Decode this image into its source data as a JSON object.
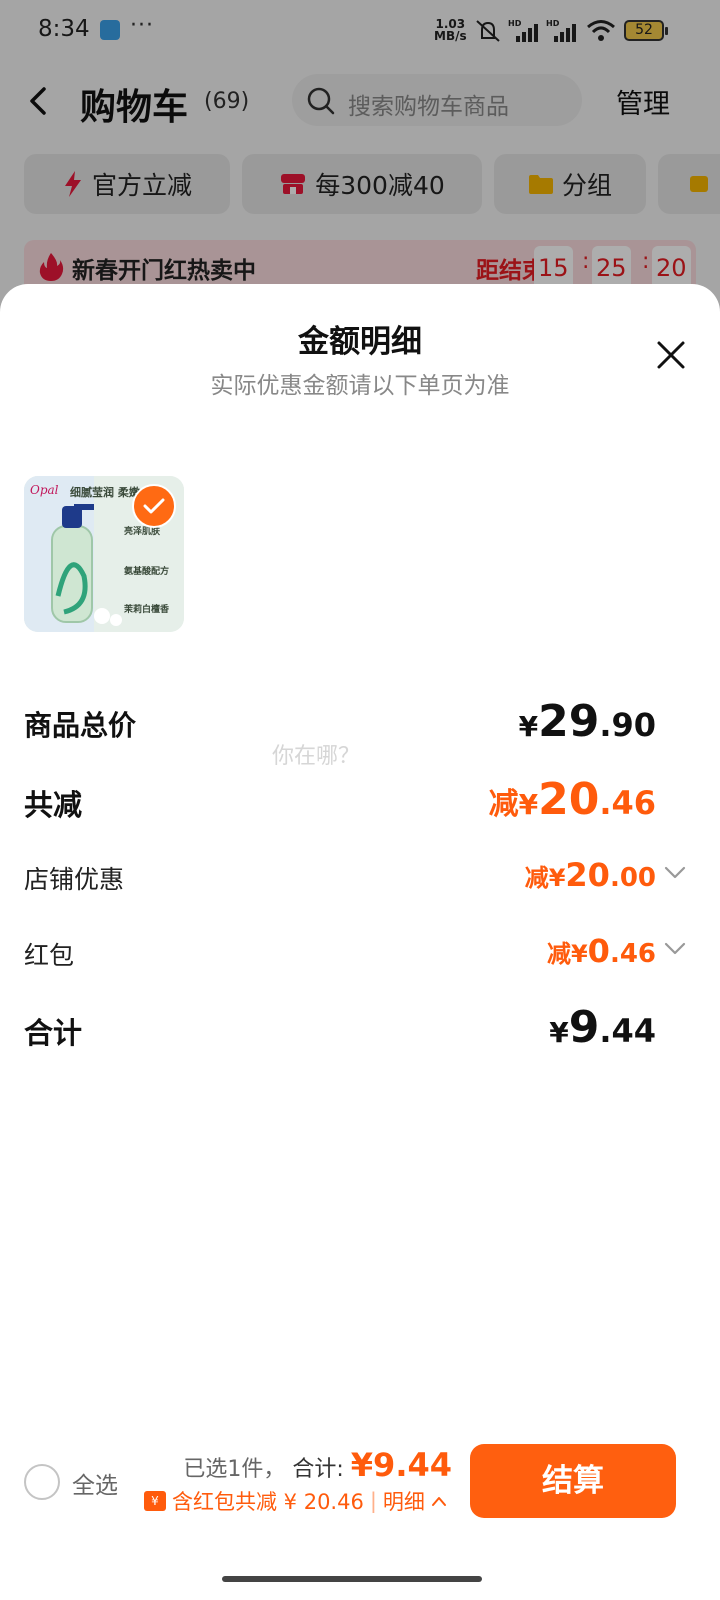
{
  "status_bar": {
    "time": "8:34",
    "more": "···",
    "net_speed_value": "1.03",
    "net_speed_unit": "MB/s",
    "battery": "52"
  },
  "nav": {
    "title": "购物车",
    "count": "(69)",
    "search_placeholder": "搜索购物车商品",
    "manage": "管理"
  },
  "chips": [
    {
      "label": "官方立减",
      "icon": "lightning-icon"
    },
    {
      "label": "每300减40",
      "icon": "shop-icon"
    },
    {
      "label": "分组",
      "icon": "folder-icon"
    }
  ],
  "banner": {
    "text": "新春开门红热卖中",
    "countdown_label": "距结束",
    "hours": "15",
    "minutes": "25",
    "seconds": "20"
  },
  "sheet": {
    "title": "金额明细",
    "subtitle": "实际优惠金额请以下单页为准",
    "product": {
      "thumb_texts": [
        "细腻莹润 柔嫩",
        "亮泽肌肤",
        "氨基酸配方",
        "茉莉白檀香"
      ]
    },
    "rows": {
      "subtotal": {
        "label": "商品总价",
        "currency": "¥",
        "int": "29",
        "dec": ".90"
      },
      "total_discount": {
        "label": "共减",
        "prefix": "减",
        "currency": "¥",
        "int": "20",
        "dec": ".46"
      },
      "shop_discount": {
        "label": "店铺优惠",
        "prefix": "减",
        "currency": "¥",
        "int": "20",
        "dec": ".00"
      },
      "red_packet": {
        "label": "红包",
        "prefix": "减",
        "currency": "¥",
        "int": "0",
        "dec": ".46"
      },
      "total": {
        "label": "合计",
        "currency": "¥",
        "int": "9",
        "dec": ".44"
      }
    },
    "watermark": "你在哪？"
  },
  "bottom_bar": {
    "select_all": "全选",
    "selected_text": "已选1件，",
    "total_label": "合计:",
    "total_value": "¥9.44",
    "discount_text": "含红包共减 ¥ 20.46",
    "detail_label": "明细",
    "checkout": "结算"
  },
  "colors": {
    "accent": "#ff5f0f",
    "discount_text": "#ff5b0c",
    "countdown": "#e51c23"
  }
}
